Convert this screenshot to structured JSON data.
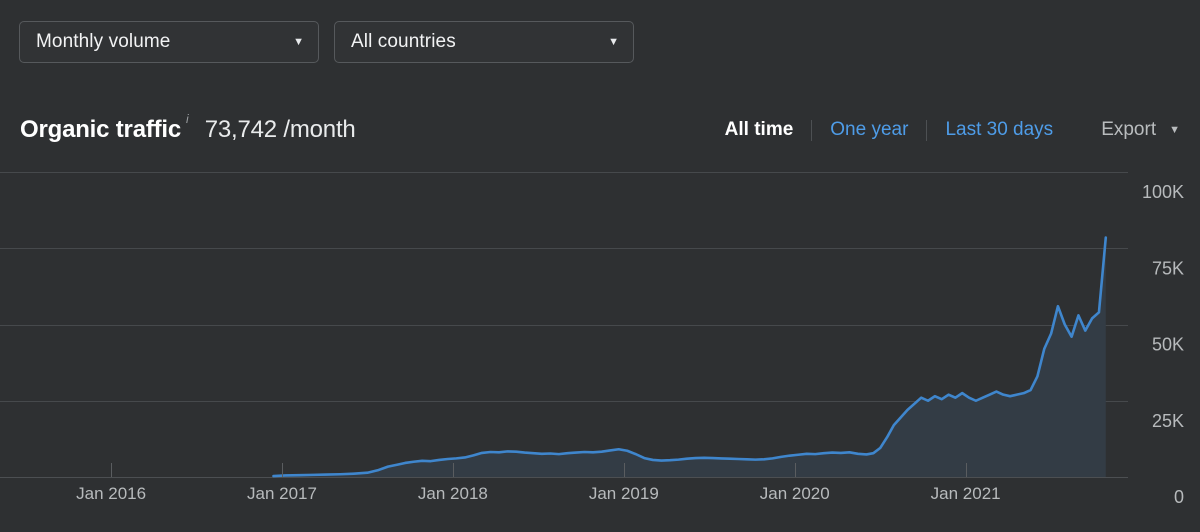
{
  "filters": [
    {
      "name": "volume",
      "label": "Monthly volume",
      "caret": "caret-down-icon"
    },
    {
      "name": "country",
      "label": "All countries",
      "caret": "caret-down-icon"
    }
  ],
  "header": {
    "metric_title": "Organic traffic",
    "info_icon": "info-icon",
    "metric_value": "73,742 /month",
    "ranges": [
      {
        "label": "All time",
        "active": true
      },
      {
        "label": "One year",
        "active": false
      },
      {
        "label": "Last 30 days",
        "active": false
      }
    ],
    "export_label": "Export",
    "export_caret": "caret-down-icon"
  },
  "colors": {
    "background": "#2e3032",
    "line": "#3f86cd",
    "area": "#333c45",
    "grid": "#46494c",
    "link": "#4e9ce8",
    "muted_text": "#b7babc"
  },
  "chart_data": {
    "type": "area",
    "title": "Organic traffic",
    "xlabel": "",
    "ylabel": "",
    "ylim": [
      0,
      100000
    ],
    "grid": true,
    "legend": false,
    "y_ticks": [
      {
        "value": 100000,
        "label": "100K"
      },
      {
        "value": 75000,
        "label": "75K"
      },
      {
        "value": 50000,
        "label": "50K"
      },
      {
        "value": 25000,
        "label": "25K"
      },
      {
        "value": 0,
        "label": "0"
      }
    ],
    "x_ticks": [
      {
        "value": 2016.0,
        "label": "Jan 2016"
      },
      {
        "value": 2017.0,
        "label": "Jan 2017"
      },
      {
        "value": 2018.0,
        "label": "Jan 2018"
      },
      {
        "value": 2019.0,
        "label": "Jan 2019"
      },
      {
        "value": 2020.0,
        "label": "Jan 2020"
      },
      {
        "value": 2021.0,
        "label": "Jan 2021"
      }
    ],
    "xlim": [
      2015.35,
      2021.95
    ],
    "series": [
      {
        "name": "Organic traffic",
        "x": [
          2016.95,
          2017.02,
          2017.1,
          2017.18,
          2017.26,
          2017.34,
          2017.42,
          2017.5,
          2017.56,
          2017.62,
          2017.68,
          2017.72,
          2017.77,
          2017.82,
          2017.87,
          2017.92,
          2017.97,
          2018.02,
          2018.07,
          2018.12,
          2018.17,
          2018.22,
          2018.27,
          2018.32,
          2018.37,
          2018.42,
          2018.47,
          2018.52,
          2018.57,
          2018.62,
          2018.67,
          2018.72,
          2018.77,
          2018.82,
          2018.87,
          2018.92,
          2018.97,
          2019.02,
          2019.07,
          2019.12,
          2019.17,
          2019.22,
          2019.27,
          2019.32,
          2019.37,
          2019.42,
          2019.47,
          2019.52,
          2019.57,
          2019.62,
          2019.67,
          2019.72,
          2019.77,
          2019.82,
          2019.87,
          2019.92,
          2019.97,
          2020.02,
          2020.07,
          2020.12,
          2020.17,
          2020.22,
          2020.27,
          2020.32,
          2020.37,
          2020.42,
          2020.46,
          2020.5,
          2020.54,
          2020.58,
          2020.62,
          2020.66,
          2020.7,
          2020.74,
          2020.78,
          2020.82,
          2020.86,
          2020.9,
          2020.94,
          2020.98,
          2021.02,
          2021.06,
          2021.1,
          2021.14,
          2021.18,
          2021.22,
          2021.26,
          2021.3,
          2021.34,
          2021.38,
          2021.42,
          2021.46,
          2021.5,
          2021.54,
          2021.58,
          2021.62,
          2021.66,
          2021.7,
          2021.74,
          2021.78,
          2021.82
        ],
        "y": [
          300,
          500,
          600,
          700,
          800,
          900,
          1100,
          1400,
          2200,
          3400,
          4100,
          4600,
          5000,
          5300,
          5200,
          5600,
          5900,
          6100,
          6400,
          7100,
          7900,
          8200,
          8100,
          8400,
          8300,
          8000,
          7800,
          7600,
          7700,
          7500,
          7800,
          8000,
          8200,
          8100,
          8300,
          8700,
          9100,
          8600,
          7500,
          6200,
          5600,
          5400,
          5500,
          5700,
          6000,
          6200,
          6300,
          6200,
          6100,
          6000,
          5900,
          5800,
          5700,
          5800,
          6100,
          6600,
          7000,
          7300,
          7600,
          7500,
          7800,
          8000,
          7900,
          8100,
          7600,
          7400,
          7800,
          9500,
          13000,
          17000,
          19500,
          22000,
          24000,
          26000,
          25000,
          26500,
          25500,
          27000,
          26000,
          27500,
          26000,
          25000,
          26000,
          27000,
          28000,
          27000,
          26500,
          27000,
          27500,
          28500,
          33000,
          42000,
          47000,
          56000,
          50000,
          46000,
          53000,
          48000,
          52000,
          54000,
          78500
        ]
      }
    ]
  }
}
